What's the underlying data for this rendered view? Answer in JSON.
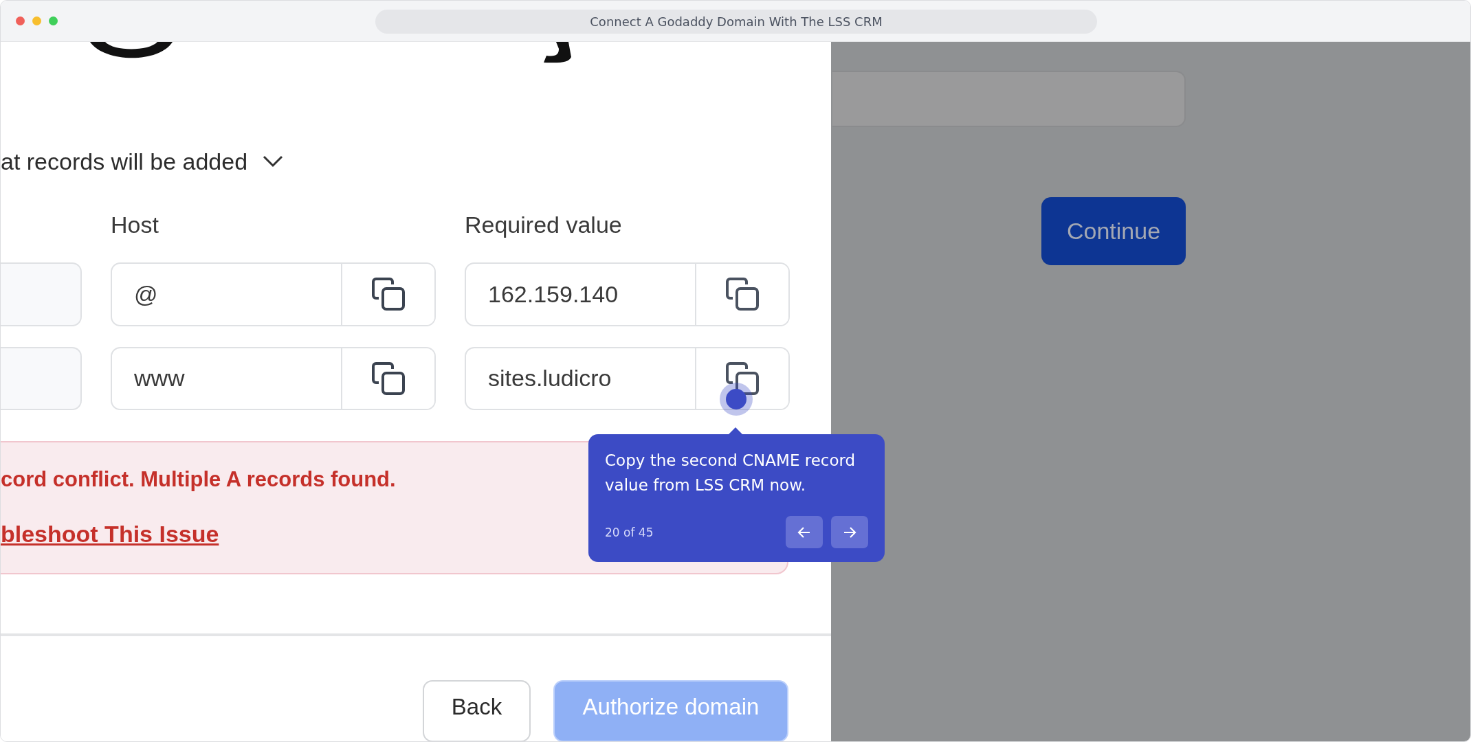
{
  "window": {
    "title": "Connect A Godaddy Domain With The LSS CRM"
  },
  "dialog": {
    "section_toggle": "at records will be added",
    "columns": [
      "Host",
      "Required value"
    ],
    "records": [
      {
        "host": "@",
        "value": "162.159.140"
      },
      {
        "host": "www",
        "value": "sites.ludicro"
      }
    ],
    "error": {
      "message": "cord conflict. Multiple A records found.",
      "link": "bleshoot This Issue"
    },
    "buttons": [
      {
        "label": "Back",
        "kind": "secondary"
      },
      {
        "label": "Authorize domain",
        "kind": "primary"
      }
    ]
  },
  "background_page": {
    "button": "Continue"
  },
  "tooltip": {
    "text": "Copy the second CNAME record value from LSS CRM now.",
    "step": "20 of 45"
  }
}
